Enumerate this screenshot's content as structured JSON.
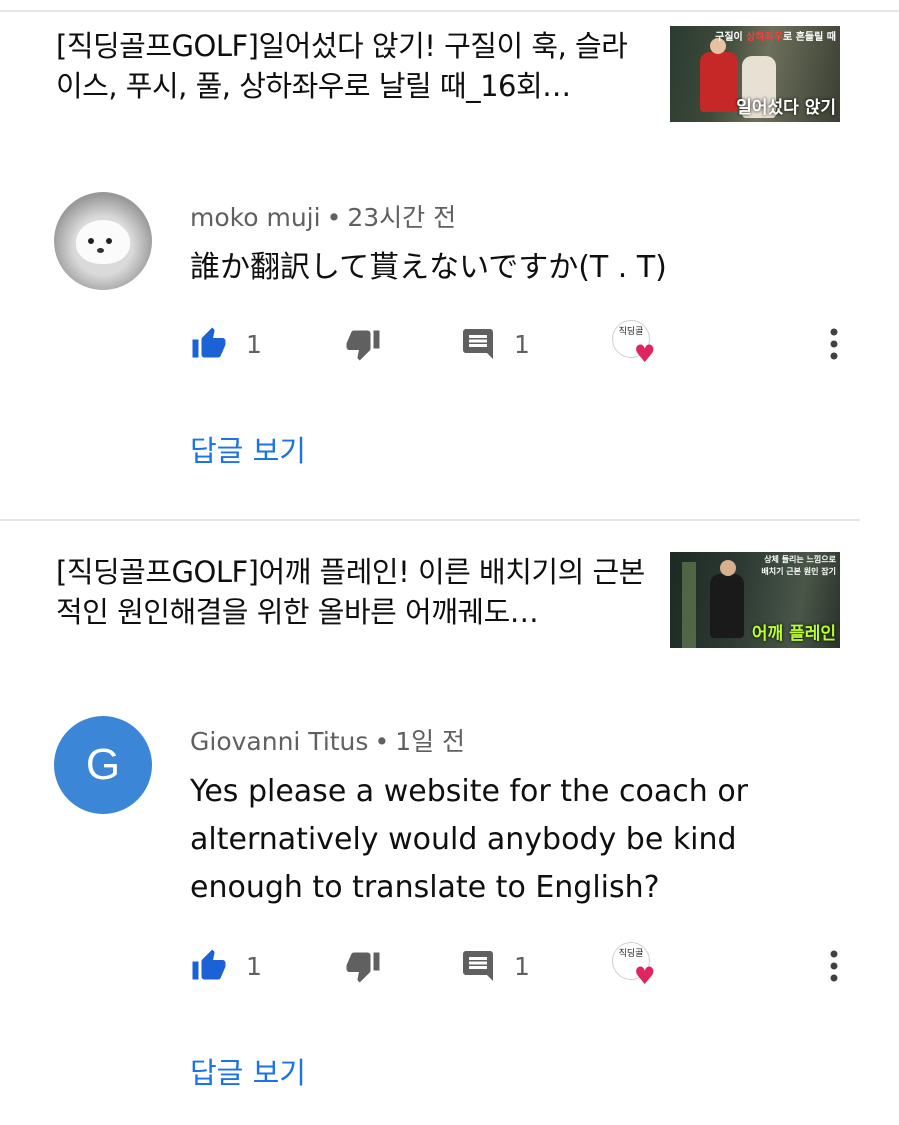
{
  "items": [
    {
      "video": {
        "title": "[직딩골프GOLF]일어섰다 앉기! 구질이 훅, 슬라이스, 푸시, 풀, 상하좌우로 날릴 때_16회…",
        "thumb_caption_top_a": "구질이 ",
        "thumb_caption_top_b": "상하좌우",
        "thumb_caption_top_c": "로 흔들릴 때",
        "thumb_caption_big": "일어섰다 앉기"
      },
      "comment": {
        "author": "moko muji",
        "time": "23시간 전",
        "text": "誰か翻訳して貰えないですか(T . T)",
        "likes": "1",
        "replies": "1",
        "view_replies": "답글 보기"
      }
    },
    {
      "video": {
        "title": "[직딩골프GOLF]어깨 플레인! 이른 배치기의 근본적인 원인해결을 위한 올바른 어깨궤도…",
        "thumb_caption_top_a": "상체 들리는 느낌으로",
        "thumb_caption_top_b": "배치기 근본 원인 잡기",
        "thumb_caption_top_c": "",
        "thumb_caption_big": "어깨 플레인"
      },
      "comment": {
        "author": "Giovanni Titus",
        "avatar_letter": "G",
        "time": "1일 전",
        "text": "Yes please a website for the coach or alternatively would anybody be kind enough to translate to English?",
        "likes": "1",
        "replies": "1",
        "view_replies": "답글 보기"
      }
    }
  ],
  "creator_badge_text": "직딩골",
  "colors": {
    "like_active": "#1a62d6",
    "link": "#1a73e8",
    "meta": "#606060",
    "heart": "#e0245e",
    "avatar_letter_bg": "#3b86d6"
  }
}
